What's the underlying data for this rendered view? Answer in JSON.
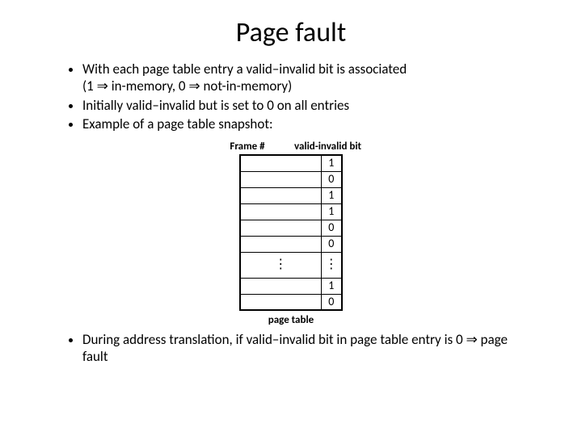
{
  "title": "Page fault",
  "bullets": {
    "b1a": "With each page table entry a valid–invalid bit is associated",
    "b1b_pre": "(1 ",
    "b1b_mid": " in-memory, 0 ",
    "b1b_post": " not-in-memory)",
    "b2": "Initially valid–invalid but is set to 0 on all entries",
    "b3": "Example of a page table snapshot:",
    "b4_pre": "During address translation, if valid–invalid bit in page table entry is 0 ",
    "b4_post": " page fault"
  },
  "implies": "⇒",
  "vdots": "⋮",
  "labels": {
    "frame_header": "Frame #",
    "valid_header": "valid-invalid bit",
    "caption": "page table"
  },
  "table": {
    "rows": [
      {
        "frame": "",
        "bit": "1"
      },
      {
        "frame": "",
        "bit": "0"
      },
      {
        "frame": "",
        "bit": "1"
      },
      {
        "frame": "",
        "bit": "1"
      },
      {
        "frame": "",
        "bit": "0"
      },
      {
        "frame": "",
        "bit": "0"
      },
      {
        "frame": "vdots",
        "bit": "vdots"
      },
      {
        "frame": "",
        "bit": "1"
      },
      {
        "frame": "",
        "bit": "0"
      }
    ]
  }
}
